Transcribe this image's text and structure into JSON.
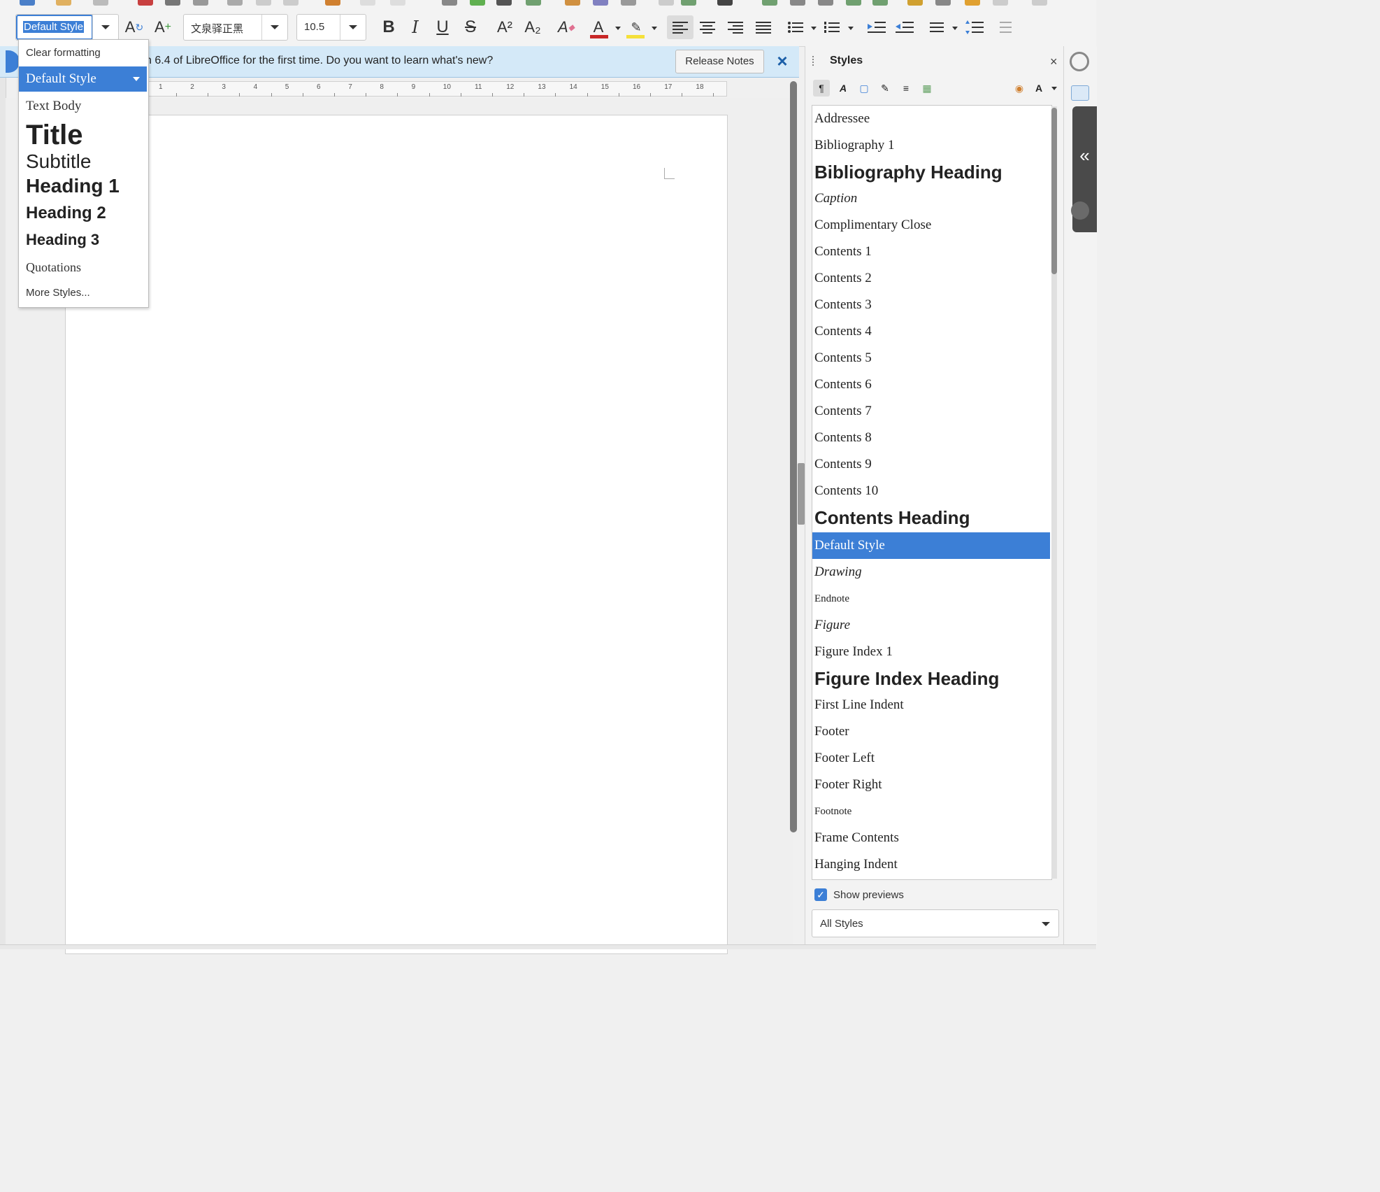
{
  "toolbar": {
    "paragraph_style": "Default Style",
    "font_name": "文泉驿正黑",
    "font_size": "10.5",
    "bold": "B",
    "italic": "I",
    "underline": "U",
    "strikethrough": "S",
    "superscript": "A²",
    "subscript": "A₂",
    "font_color": "#c82828",
    "highlight_color": "#f5e03a"
  },
  "infobar": {
    "message": "n 6.4 of LibreOffice for the first time. Do you want to learn what's new?",
    "button_label": "Release Notes",
    "close_icon": "×"
  },
  "ruler": {
    "marks": [
      "1",
      "2",
      "3",
      "4",
      "5",
      "6",
      "7",
      "8",
      "9",
      "10",
      "11",
      "12",
      "13",
      "14",
      "15",
      "16",
      "17",
      "18"
    ]
  },
  "styles_dropdown": {
    "clear_formatting": "Clear formatting",
    "items": [
      "Default Style",
      "Text Body",
      "Title",
      "Subtitle",
      "Heading 1",
      "Heading 2",
      "Heading 3",
      "Quotations"
    ],
    "more": "More Styles..."
  },
  "sidebar": {
    "title": "Styles",
    "close_icon": "×",
    "styles": [
      "Addressee",
      "Bibliography 1",
      "Bibliography Heading",
      "Caption",
      "Complimentary Close",
      "Contents 1",
      "Contents 2",
      "Contents 3",
      "Contents 4",
      "Contents 5",
      "Contents 6",
      "Contents 7",
      "Contents 8",
      "Contents 9",
      "Contents 10",
      "Contents Heading",
      "Default Style",
      "Drawing",
      "Endnote",
      "Figure",
      "Figure Index 1",
      "Figure Index Heading",
      "First Line Indent",
      "Footer",
      "Footer Left",
      "Footer Right",
      "Footnote",
      "Frame Contents",
      "Hanging Indent"
    ],
    "selected": "Default Style",
    "show_previews_label": "Show previews",
    "show_previews_checked": true,
    "filter": "All Styles"
  },
  "deck": {
    "expand_icon": "«"
  },
  "colors": {
    "accent": "#3c7fd6",
    "infobar_bg": "#d4e9f8"
  }
}
